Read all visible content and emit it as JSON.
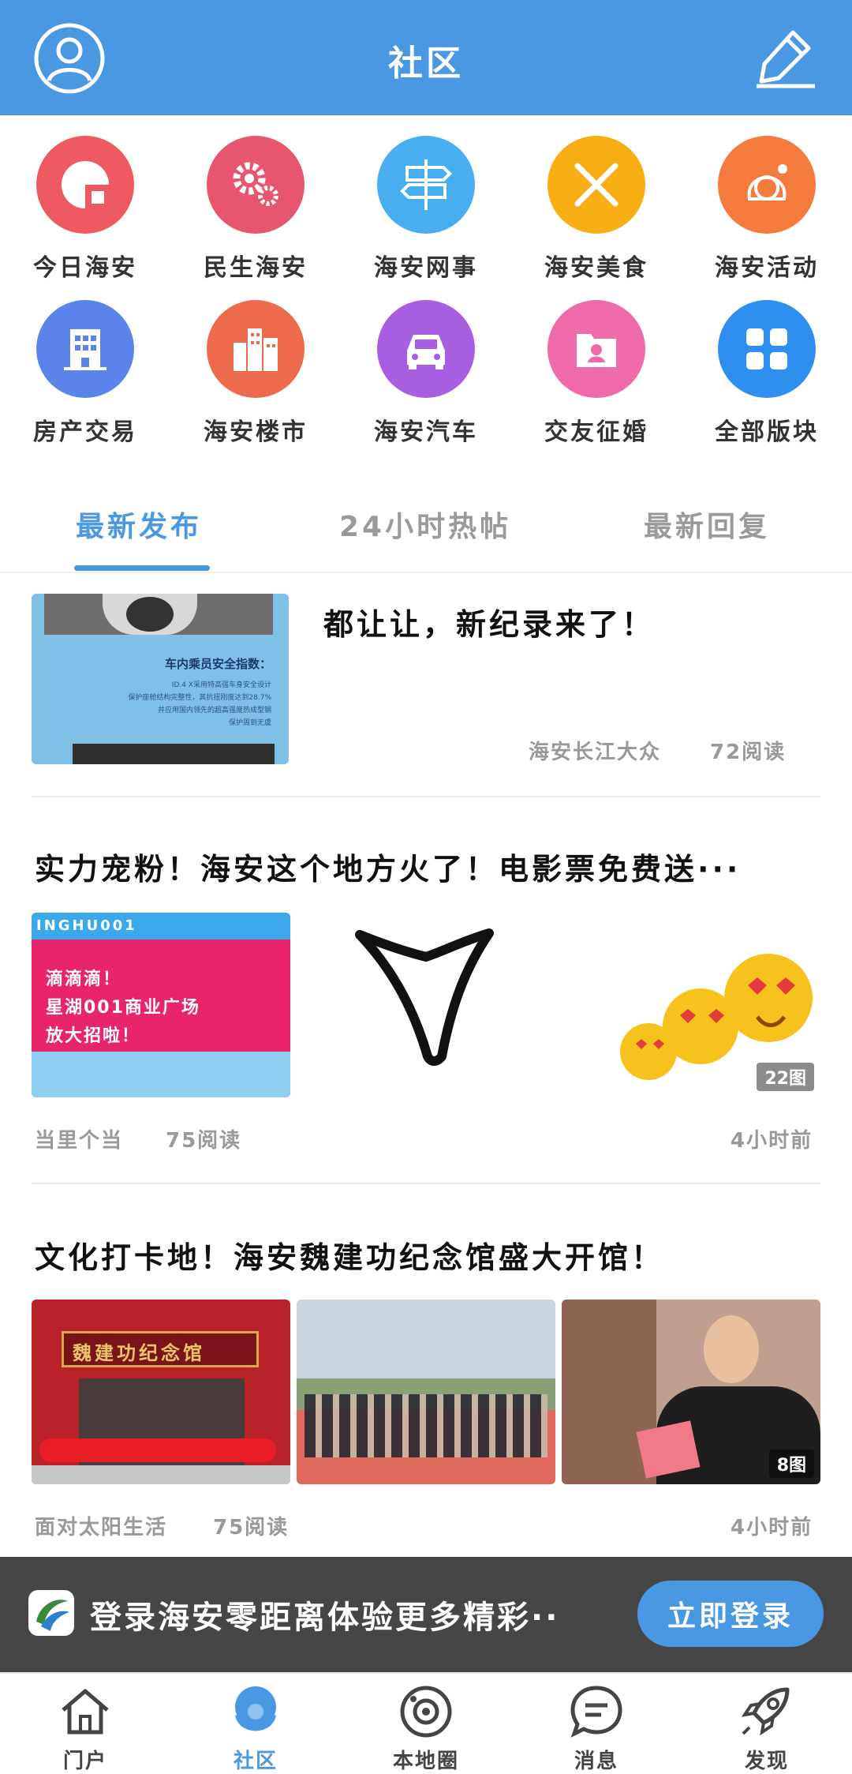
{
  "header": {
    "title": "社区",
    "left_icon": "user-avatar-icon",
    "right_icon": "edit-pencil-icon"
  },
  "categories": [
    {
      "label": "今日海安",
      "icon": "today-icon",
      "color": "#ee5a5f"
    },
    {
      "label": "民生海安",
      "icon": "gears-icon",
      "color": "#e8566e"
    },
    {
      "label": "海安网事",
      "icon": "signpost-icon",
      "color": "#49aef0"
    },
    {
      "label": "海安美食",
      "icon": "fork-knife-icon",
      "color": "#f7ae14"
    },
    {
      "label": "海安活动",
      "icon": "girl-face-icon",
      "color": "#f57a3d"
    },
    {
      "label": "房产交易",
      "icon": "building-icon",
      "color": "#5b84ea"
    },
    {
      "label": "海安楼市",
      "icon": "city-buildings-icon",
      "color": "#ee6a4d"
    },
    {
      "label": "海安汽车",
      "icon": "car-icon",
      "color": "#a85ee0"
    },
    {
      "label": "交友征婚",
      "icon": "person-folder-icon",
      "color": "#ee6aa8"
    },
    {
      "label": "全部版块",
      "icon": "apps-grid-icon",
      "color": "#2f8ff0"
    }
  ],
  "tabs": [
    {
      "label": "最新发布",
      "active": true
    },
    {
      "label": "24小时热帖",
      "active": false
    },
    {
      "label": "最新回复",
      "active": false
    }
  ],
  "posts": [
    {
      "title": "都让让，新纪录来了！",
      "author": "海安长江大众",
      "reads": "72阅读",
      "thumb_text": "车内乘员安全指数：",
      "thumb_sub1": "ID.4 X采用特高强车身安全设计",
      "thumb_sub2": "保护座舱结构完整性，其抗扭刚度达到28.7%",
      "thumb_sub3": "并应用国内领先的超高强度热成型钢",
      "thumb_sub4": "保护周到无虞"
    },
    {
      "title": "实力宠粉！海安这个地方火了！电影票免费送···",
      "author": "当里个当",
      "reads": "75阅读",
      "time": "4小时前",
      "thumb_banner": "INGHU001",
      "thumb_line1": "滴滴滴！",
      "thumb_line2": "星湖001商业广场",
      "thumb_line3": "放大招啦！",
      "image_count": "22图"
    },
    {
      "title": "文化打卡地！海安魏建功纪念馆盛大开馆！",
      "author": "面对太阳生活",
      "reads": "75阅读",
      "time": "4小时前",
      "hall_sign": "魏建功纪念馆",
      "image_count": "8图"
    }
  ],
  "login_banner": {
    "text": "登录海安零距离体验更多精彩··",
    "button": "立即登录"
  },
  "bottom_nav": [
    {
      "label": "门户",
      "icon": "home-icon",
      "active": false
    },
    {
      "label": "社区",
      "icon": "community-icon",
      "active": true
    },
    {
      "label": "本地圈",
      "icon": "local-circle-icon",
      "active": false
    },
    {
      "label": "消息",
      "icon": "message-icon",
      "active": false
    },
    {
      "label": "发现",
      "icon": "rocket-icon",
      "active": false
    }
  ]
}
